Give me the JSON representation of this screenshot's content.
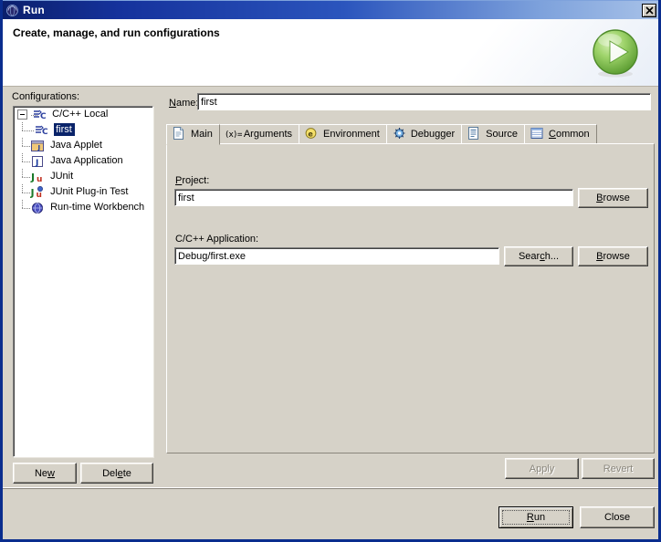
{
  "window": {
    "title": "Run",
    "icon": "eclipse-run-icon",
    "close_label": "✕",
    "titlebar_gradient_start": "#0b1f6b",
    "titlebar_gradient_end": "#a8c2e8"
  },
  "banner": {
    "title": "Create, manage, and run configurations",
    "graphic": "green-run-play-icon",
    "graphic_color": "#74c044"
  },
  "left_pane": {
    "configs_label_pre": "Confi",
    "configs_label_accel": "g",
    "configs_label_post": "urations:",
    "tree": [
      {
        "label": "C/C++ Local",
        "icon": "cpp-config-icon",
        "depth": 0,
        "expandable": true,
        "selected": false
      },
      {
        "label": "first",
        "icon": "cpp-config-icon",
        "depth": 1,
        "expandable": false,
        "selected": true
      },
      {
        "label": "Java Applet",
        "icon": "java-applet-icon",
        "depth": 0,
        "expandable": false,
        "selected": false
      },
      {
        "label": "Java Application",
        "icon": "java-application-icon",
        "depth": 0,
        "expandable": false,
        "selected": false
      },
      {
        "label": "JUnit",
        "icon": "junit-icon",
        "depth": 0,
        "expandable": false,
        "selected": false
      },
      {
        "label": "JUnit Plug-in Test",
        "icon": "junit-plugin-icon",
        "depth": 0,
        "expandable": false,
        "selected": false
      },
      {
        "label": "Run-time Workbench",
        "icon": "runtime-workbench-icon",
        "depth": 0,
        "expandable": false,
        "selected": false
      }
    ],
    "new_button": {
      "pre": "Ne",
      "accel": "w",
      "post": ""
    },
    "delete_button": {
      "pre": "Del",
      "accel": "e",
      "post": "te"
    }
  },
  "right_pane": {
    "name_label": {
      "pre": "",
      "accel": "N",
      "post": "ame:"
    },
    "name_value": "first",
    "tabs": [
      {
        "label": "Main",
        "icon": "document-icon",
        "active": true,
        "accel": ""
      },
      {
        "label": "Arguments",
        "icon": "variable-xequals-icon",
        "active": false,
        "accel": ""
      },
      {
        "label": "Environment",
        "icon": "environment-circle-icon",
        "active": false,
        "accel": ""
      },
      {
        "label": "Debugger",
        "icon": "bug-debugger-icon",
        "active": false,
        "accel": ""
      },
      {
        "label": "Source",
        "icon": "source-list-icon",
        "active": false,
        "accel": ""
      },
      {
        "label": "Common",
        "icon": "common-table-icon",
        "active": false,
        "accel": "C"
      }
    ],
    "project": {
      "label": {
        "pre": "",
        "accel": "P",
        "post": "roject:"
      },
      "value": "first",
      "browse_button": {
        "pre": "",
        "accel": "B",
        "post": "rowse"
      }
    },
    "application": {
      "label": "C/C++ Application:",
      "value": "Debug/first.exe",
      "search_button": {
        "pre": "Sear",
        "accel": "c",
        "post": "h..."
      },
      "browse_button": {
        "pre": "",
        "accel": "B",
        "post": "rowse"
      }
    },
    "apply_button": {
      "label": "Apply",
      "enabled": false
    },
    "revert_button": {
      "label": "Revert",
      "enabled": false
    }
  },
  "footer": {
    "run_button": {
      "pre": "",
      "accel": "R",
      "post": "un",
      "default": true
    },
    "close_button": {
      "label": "Close",
      "default": false
    }
  }
}
